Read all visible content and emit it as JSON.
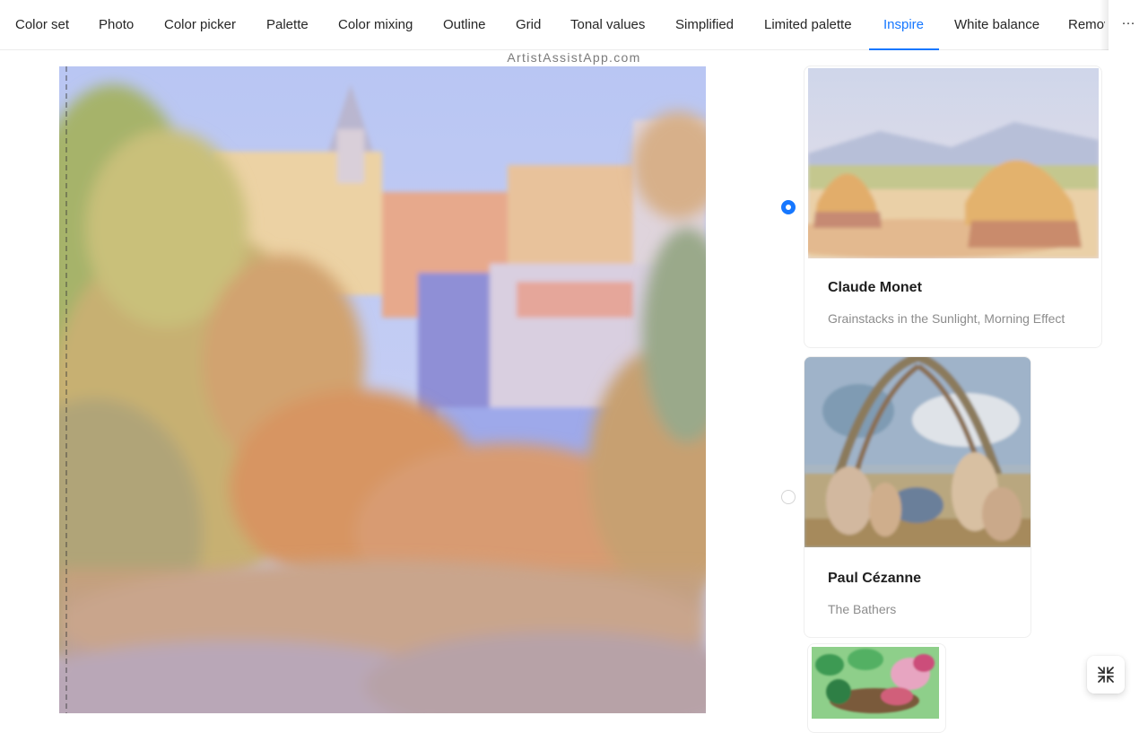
{
  "tabs": [
    {
      "label": "Color set",
      "active": false
    },
    {
      "label": "Photo",
      "active": false
    },
    {
      "label": "Color picker",
      "active": false
    },
    {
      "label": "Palette",
      "active": false
    },
    {
      "label": "Color mixing",
      "active": false
    },
    {
      "label": "Outline",
      "active": false
    },
    {
      "label": "Grid",
      "active": false
    },
    {
      "label": "Tonal values",
      "active": false
    },
    {
      "label": "Simplified",
      "active": false
    },
    {
      "label": "Limited palette",
      "active": false
    },
    {
      "label": "Inspire",
      "active": true
    },
    {
      "label": "White balance",
      "active": false
    },
    {
      "label": "Remov",
      "active": false
    }
  ],
  "more_label": "···",
  "more_icon": "ellipsis-icon",
  "watermark": "ArtistAssistApp.com",
  "painting": {
    "style": "impressionist street scene",
    "icon": "painting-preview"
  },
  "artworks": [
    {
      "artist": "Claude Monet",
      "title": "Grainstacks in the Sunlight, Morning Effect",
      "selected": true
    },
    {
      "artist": "Paul Cézanne",
      "title": "The Bathers",
      "selected": false
    },
    {
      "artist": "",
      "title": "",
      "selected": false
    }
  ],
  "float_button": {
    "icon": "compress-icon"
  },
  "colors": {
    "accent": "#1677ff",
    "text": "#262626",
    "muted": "#8c8c8c"
  }
}
